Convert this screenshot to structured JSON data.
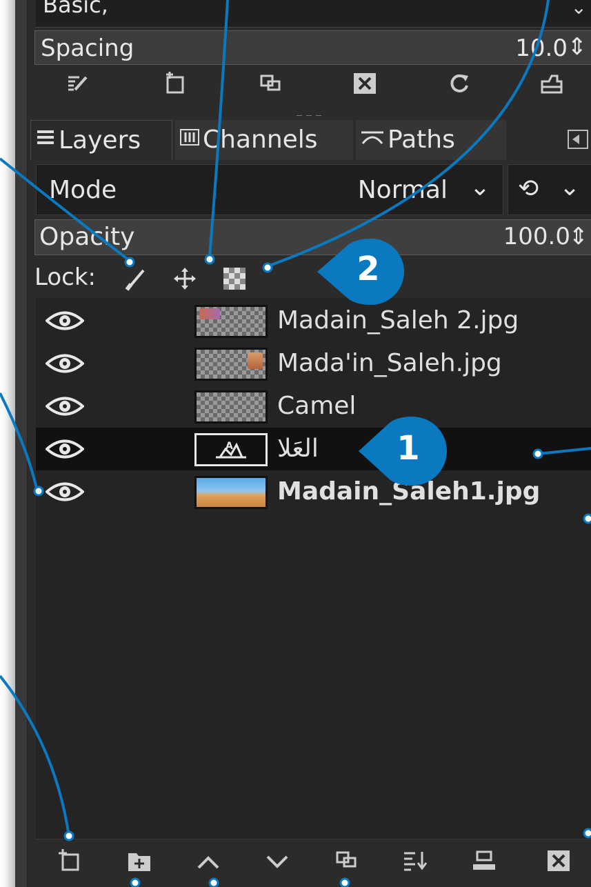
{
  "brush_options": {
    "preset_label": "Basic,",
    "spacing_label": "Spacing",
    "spacing_value": "10.0"
  },
  "tabs": [
    {
      "label": "Layers",
      "icon": "layers-icon"
    },
    {
      "label": "Channels",
      "icon": "channels-icon"
    },
    {
      "label": "Paths",
      "icon": "paths-icon"
    }
  ],
  "layers_panel": {
    "mode_label": "Mode",
    "mode_value": "Normal",
    "opacity_label": "Opacity",
    "opacity_value": "100.0",
    "lock_label": "Lock:",
    "layers": [
      {
        "name": "Madain_Saleh 2.jpg",
        "visible": true,
        "thumbnail": "partial-photo-top-left"
      },
      {
        "name": "Mada'in_Saleh.jpg",
        "visible": true,
        "thumbnail": "partial-photo-top-right"
      },
      {
        "name": "Camel",
        "visible": true,
        "thumbnail": "transparent"
      },
      {
        "name": "العَلا",
        "visible": true,
        "thumbnail": "text-layer",
        "selected": true
      },
      {
        "name": "Madain_Saleh1.jpg",
        "visible": true,
        "thumbnail": "desert-photo",
        "bold": true
      }
    ]
  },
  "callouts": [
    {
      "number": "2"
    },
    {
      "number": "1"
    }
  ],
  "colors": {
    "callout_blue": "#0b79bf",
    "panel_bg": "#2b2b2b",
    "selected_row": "#111111"
  }
}
